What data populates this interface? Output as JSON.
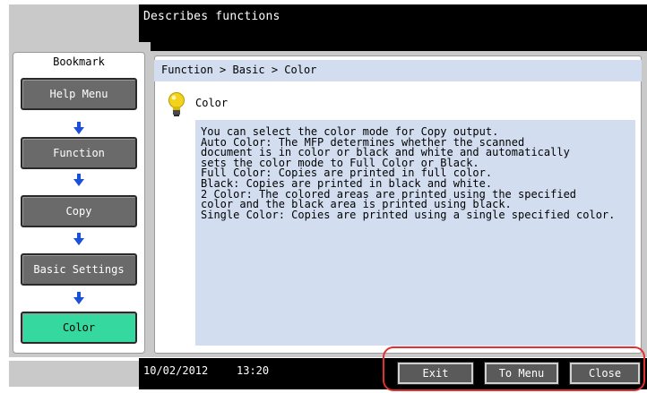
{
  "header": {
    "title": "Describes functions"
  },
  "bookmark": {
    "title": "Bookmark",
    "items": [
      {
        "label": "Help Menu",
        "active": false
      },
      {
        "label": "Function",
        "active": false
      },
      {
        "label": "Copy",
        "active": false
      },
      {
        "label": "Basic Settings",
        "active": false
      },
      {
        "label": "Color",
        "active": true
      }
    ]
  },
  "content": {
    "breadcrumb": "Function > Basic > Color",
    "item_icon": "lightbulb-icon",
    "item_title": "Color",
    "description": "You can select the color mode for Copy output.\nAuto Color: The MFP determines whether the scanned\ndocument is in color or black and white and automatically\nsets the color mode to Full Color or Black.\nFull Color: Copies are printed in full color.\nBlack: Copies are printed in black and white.\n2 Color: The colored areas are printed using the specified\ncolor and the black area is printed using black.\nSingle Color: Copies are printed using a single specified color."
  },
  "footer": {
    "date": "10/02/2012",
    "time": "13:20",
    "buttons": {
      "exit": "Exit",
      "to_menu": "To Menu",
      "close": "Close"
    }
  },
  "colors": {
    "active_bookmark": "#35d99f",
    "button_gray": "#6a6a6a",
    "panel_blue": "#d2def0",
    "highlight": "#e03030"
  }
}
